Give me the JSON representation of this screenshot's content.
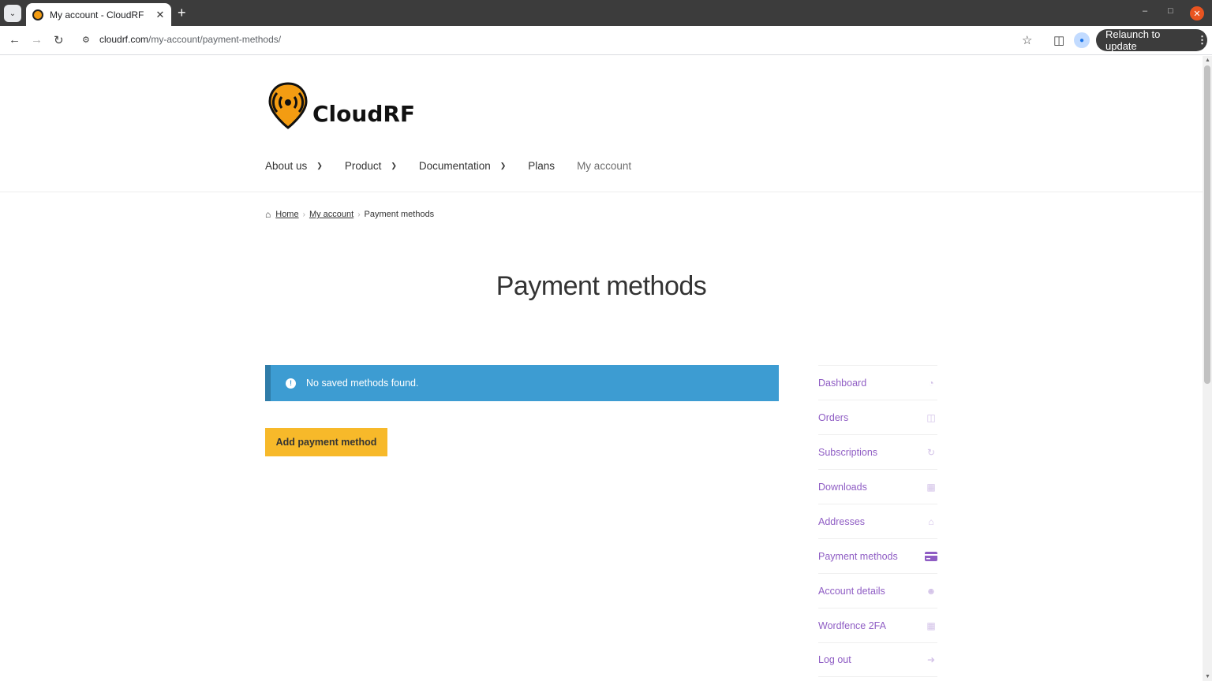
{
  "browser": {
    "tab_title": "My account - CloudRF",
    "url_domain": "cloudrf.com",
    "url_path": "/my-account/payment-methods/",
    "relaunch_label": "Relaunch to update"
  },
  "site": {
    "logo_text": "CloudRF",
    "brand_color": "#f39c12"
  },
  "nav": {
    "items": [
      {
        "label": "About us",
        "dropdown": true
      },
      {
        "label": "Product",
        "dropdown": true
      },
      {
        "label": "Documentation",
        "dropdown": true
      },
      {
        "label": "Plans",
        "dropdown": false
      },
      {
        "label": "My account",
        "dropdown": false
      }
    ]
  },
  "breadcrumb": {
    "home": "Home",
    "my_account": "My account",
    "current": "Payment methods"
  },
  "page": {
    "title": "Payment methods",
    "notice": "No saved methods found.",
    "add_button": "Add payment method",
    "notice_color": "#3d9cd2",
    "button_color": "#f7b92a"
  },
  "account_nav": {
    "items": [
      {
        "label": "Dashboard",
        "icon": "dashboard-icon"
      },
      {
        "label": "Orders",
        "icon": "basket-icon"
      },
      {
        "label": "Subscriptions",
        "icon": "refresh-icon"
      },
      {
        "label": "Downloads",
        "icon": "file-icon"
      },
      {
        "label": "Addresses",
        "icon": "home-icon"
      },
      {
        "label": "Payment methods",
        "icon": "credit-card-icon",
        "active": true
      },
      {
        "label": "Account details",
        "icon": "user-icon"
      },
      {
        "label": "Wordfence 2FA",
        "icon": "building-icon"
      },
      {
        "label": "Log out",
        "icon": "sign-out-icon"
      }
    ],
    "link_color": "#8f5dc4"
  }
}
